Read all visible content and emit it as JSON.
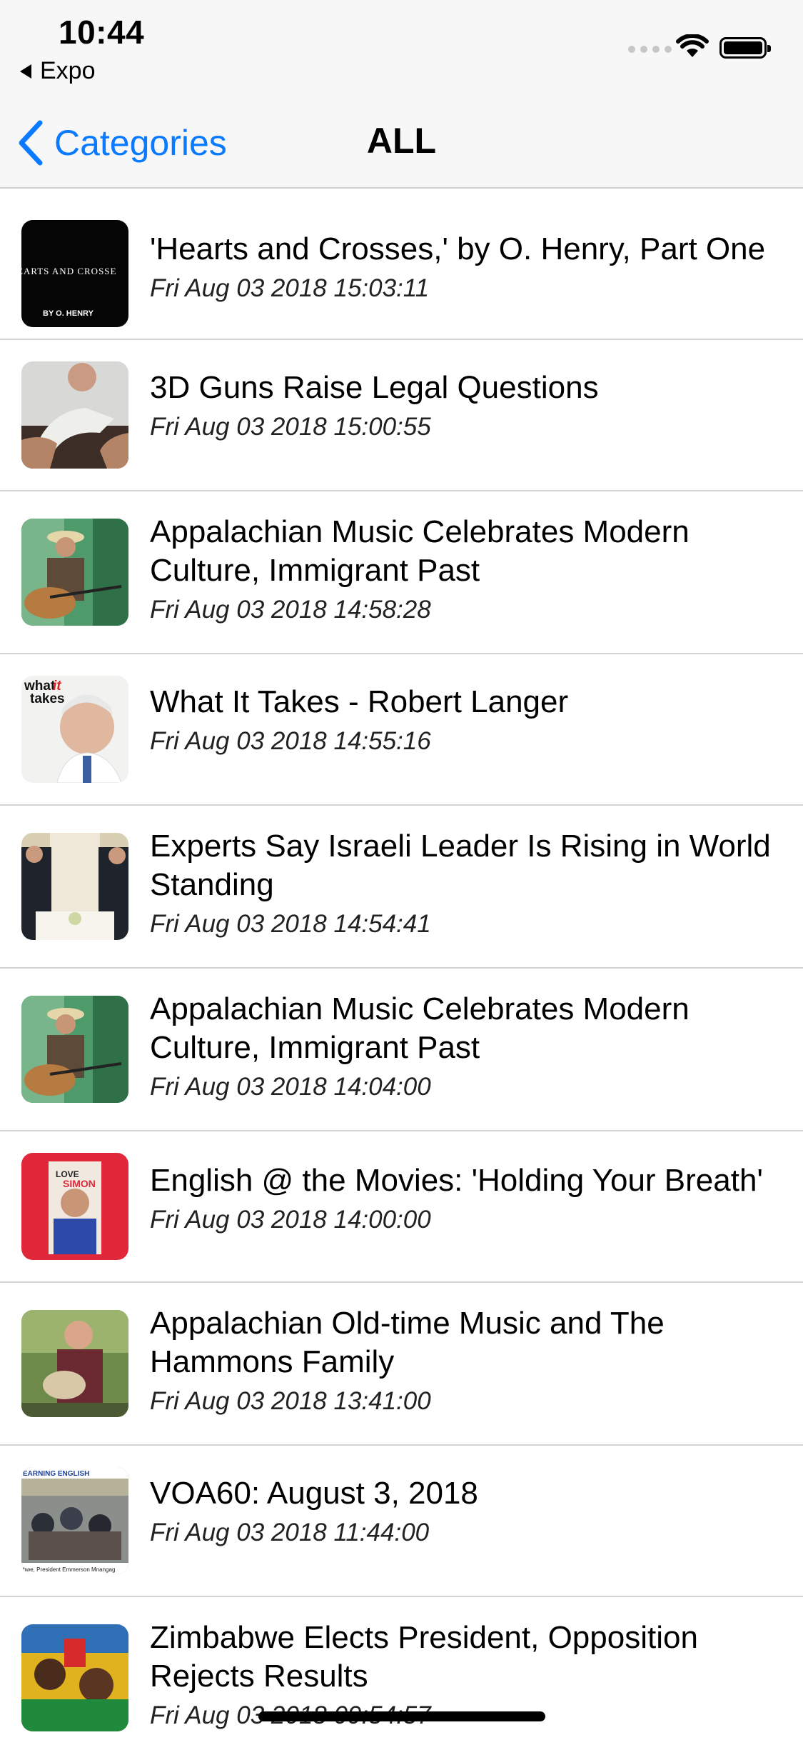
{
  "status": {
    "time": "10:44",
    "back_app": "Expo"
  },
  "nav": {
    "back_label": "Categories",
    "title": "ALL"
  },
  "items": [
    {
      "title": "'Hearts and Crosses,' by O. Henry, Part One",
      "date": "Fri Aug 03 2018 15:03:11",
      "thumb_text": [
        "EARTS AND CROSSE",
        "BY O. HENRY"
      ]
    },
    {
      "title": "3D Guns Raise Legal Questions",
      "date": "Fri Aug 03 2018 15:00:55"
    },
    {
      "title": "Appalachian Music Celebrates Modern Culture, Immigrant Past",
      "date": "Fri Aug 03 2018 14:58:28"
    },
    {
      "title": "What It Takes - Robert Langer",
      "date": "Fri Aug 03 2018 14:55:16",
      "thumb_text": [
        "what",
        "it",
        "takes"
      ]
    },
    {
      "title": "Experts Say Israeli Leader Is Rising in World Standing",
      "date": "Fri Aug 03 2018 14:54:41"
    },
    {
      "title": "Appalachian Music Celebrates Modern Culture, Immigrant Past",
      "date": "Fri Aug 03 2018 14:04:00"
    },
    {
      "title": "English @ the Movies: 'Holding Your Breath'",
      "date": "Fri Aug 03 2018 14:00:00",
      "thumb_text": [
        "LOVE",
        "SIMON"
      ]
    },
    {
      "title": "Appalachian Old-time Music and The Hammons Family",
      "date": "Fri Aug 03 2018 13:41:00"
    },
    {
      "title": "VOA60: August 3, 2018",
      "date": "Fri Aug 03 2018 11:44:00",
      "thumb_text": [
        "EARNING ENGLISH",
        "bwe, President Emmerson Mnangag"
      ]
    },
    {
      "title": "Zimbabwe Elects President, Opposition Rejects Results",
      "date": "Fri Aug 03 2018 09:54:57"
    }
  ],
  "colors": {
    "accent": "#0a7aff",
    "bar_bg": "#f7f7f7",
    "separator": "#d4d4d8"
  },
  "icons": [
    "back-triangle-icon",
    "signal-dots-icon",
    "wifi-icon",
    "battery-icon",
    "chevron-left-icon"
  ]
}
